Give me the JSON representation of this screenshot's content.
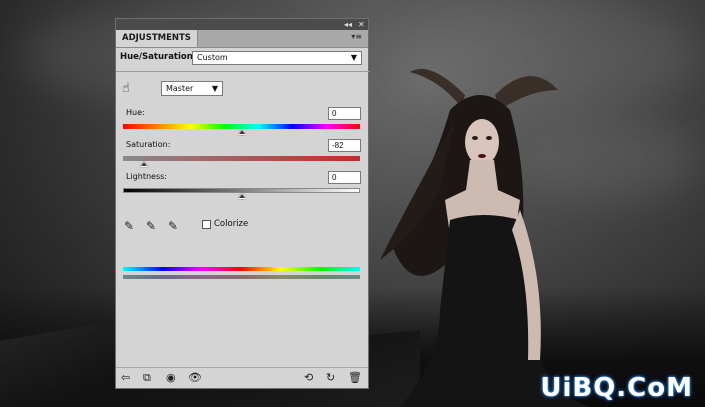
{
  "panel": {
    "tab_title": "ADJUSTMENTS",
    "adjustment_name": "Hue/Saturation",
    "preset_value": "Custom",
    "channel_value": "Master",
    "hue_label": "Hue:",
    "hue_value": "0",
    "hue_fraction": 0.5,
    "saturation_label": "Saturation:",
    "saturation_value": "-82",
    "saturation_fraction": 0.09,
    "lightness_label": "Lightness:",
    "lightness_value": "0",
    "lightness_fraction": 0.5,
    "colorize_label": "Colorize",
    "colorize_checked": false
  },
  "icons": {
    "hand": "on-image-adjust-icon",
    "eyedropper": "eyedropper-icon",
    "eyedropper_plus": "eyedropper-add-icon",
    "eyedropper_minus": "eyedropper-subtract-icon"
  },
  "watermark": "UiBQ.CoM",
  "colors": {
    "panel_bg": "#d4d4d4",
    "panel_header": "#4b4b4b",
    "saturation_bar": "#c62a2a"
  }
}
